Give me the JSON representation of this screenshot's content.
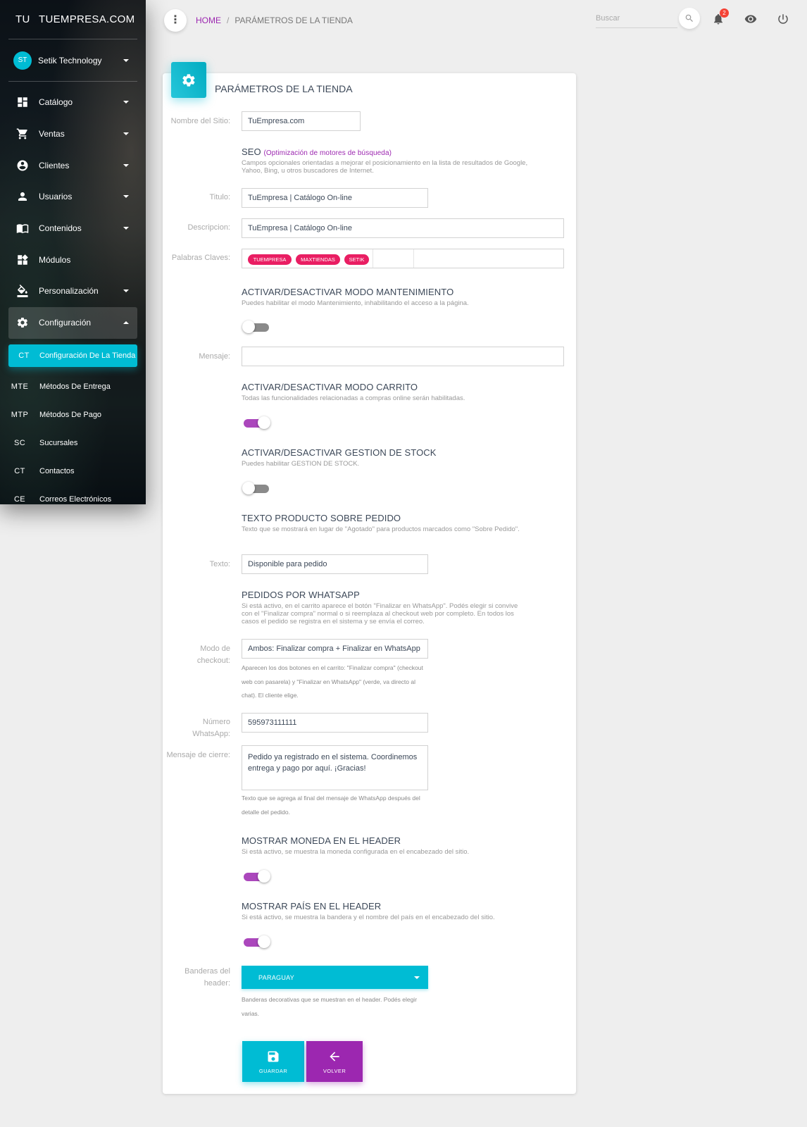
{
  "sidebar": {
    "logo_mini": "TU",
    "logo_text": "TUEMPRESA.COM",
    "user": {
      "initials": "ST",
      "name": "Setik Technology"
    },
    "items": [
      {
        "label": "Catálogo",
        "icon": "dashboard-icon"
      },
      {
        "label": "Ventas",
        "icon": "cart-icon"
      },
      {
        "label": "Clientes",
        "icon": "account-circle-icon"
      },
      {
        "label": "Usuarios",
        "icon": "person-icon"
      },
      {
        "label": "Contenidos",
        "icon": "book-icon"
      },
      {
        "label": "Módulos",
        "icon": "widgets-icon"
      },
      {
        "label": "Personalización",
        "icon": "paint-bucket-icon"
      },
      {
        "label": "Configuración",
        "icon": "gear-icon"
      }
    ],
    "sub_items": [
      {
        "abbr": "CT",
        "label": "Configuración De La Tienda"
      },
      {
        "abbr": "MTE",
        "label": "Métodos De Entrega"
      },
      {
        "abbr": "MTP",
        "label": "Métodos De Pago"
      },
      {
        "abbr": "SC",
        "label": "Sucursales"
      },
      {
        "abbr": "CT",
        "label": "Contactos"
      },
      {
        "abbr": "CE",
        "label": "Correos Electrónicos"
      }
    ]
  },
  "topbar": {
    "breadcrumb_home": "HOME",
    "breadcrumb_sep": "/",
    "breadcrumb_current": "PARÁMETROS DE LA TIENDA",
    "search_placeholder": "Buscar",
    "notifications_count": "2"
  },
  "form": {
    "title": "PARÁMETROS DE LA TIENDA",
    "site_name_label": "Nombre del Sitio:",
    "site_name_value": "TuEmpresa.com",
    "seo_title": "SEO",
    "seo_hint": "(Optimización de motores de búsqueda)",
    "seo_sub": "Campos opcionales orientadas a mejorar el posicionamiento en la lista de resultados de Google, Yahoo, Bing, u otros buscadores de Internet.",
    "titulo_label": "Titulo:",
    "titulo_value": "TuEmpresa | Catálogo On-line",
    "descripcion_label": "Descripcion:",
    "descripcion_value": "TuEmpresa | Catálogo On-line",
    "keywords_label": "Palabras Claves:",
    "keywords": [
      "TUEMPRESA",
      "MAXTIENDAS",
      "SETIK"
    ],
    "maint_title": "ACTIVAR/DESACTIVAR MODO MANTENIMIENTO",
    "maint_sub": "Puedes habilitar el modo Mantenimiento, inhabilitando el acceso a la página.",
    "maint_on": false,
    "mensaje_label": "Mensaje:",
    "mensaje_value": "",
    "cart_title": "ACTIVAR/DESACTIVAR MODO CARRITO",
    "cart_sub": "Todas las funcionalidades relacionadas a compras online serán habilitadas.",
    "cart_on": true,
    "stock_title": "ACTIVAR/DESACTIVAR GESTION DE STOCK",
    "stock_sub": "Puedes habilitar GESTION DE STOCK.",
    "stock_on": false,
    "pedido_title": "TEXTO PRODUCTO SOBRE PEDIDO",
    "pedido_sub": "Texto que se mostrará en lugar de \"Agotado\" para productos marcados como \"Sobre Pedido\".",
    "texto_label": "Texto:",
    "texto_value": "Disponible para pedido",
    "wa_title": "PEDIDOS POR WHATSAPP",
    "wa_sub": "Si está activo, en el carrito aparece el botón \"Finalizar en WhatsApp\". Podés elegir si convive con el \"Finalizar compra\" normal o si reemplaza al checkout web por completo. En todos los casos el pedido se registra en el sistema y se envía el correo.",
    "checkout_label_1": "Modo de",
    "checkout_label_2": "checkout:",
    "checkout_value": "Ambos: Finalizar compra + Finalizar en WhatsApp",
    "checkout_hint": "Aparecen los dos botones en el carrito: \"Finalizar compra\" (checkout web con pasarela) y \"Finalizar en WhatsApp\" (verde, va directo al chat). El cliente elige.",
    "wa_number_label_1": "Número",
    "wa_number_label_2": "WhatsApp:",
    "wa_number_value": "595973111111",
    "closing_label": "Mensaje de cierre:",
    "closing_value": "Pedido ya registrado en el sistema. Coordinemos entrega y pago por aquí. ¡Gracias!",
    "closing_hint": "Texto que se agrega al final del mensaje de WhatsApp después del detalle del pedido.",
    "currency_title": "MOSTRAR MONEDA EN EL HEADER",
    "currency_sub": "Si está activo, se muestra la moneda configurada en el encabezado del sitio.",
    "currency_on": true,
    "country_title": "MOSTRAR PAÍS EN EL HEADER",
    "country_sub": "Si está activo, se muestra la bandera y el nombre del país en el encabezado del sitio.",
    "country_on": true,
    "flags_label_1": "Banderas del",
    "flags_label_2": "header:",
    "flags_value": "PARAGUAY",
    "flags_hint": "Banderas decorativas que se muestran en el header. Podés elegir varias.",
    "save_label": "GUARDAR",
    "back_label": "VOLVER"
  },
  "colors": {
    "accent_cyan": "#00bcd4",
    "accent_purple": "#9c27b0",
    "tag_pink": "#e91e63",
    "badge_red": "#f44336"
  }
}
